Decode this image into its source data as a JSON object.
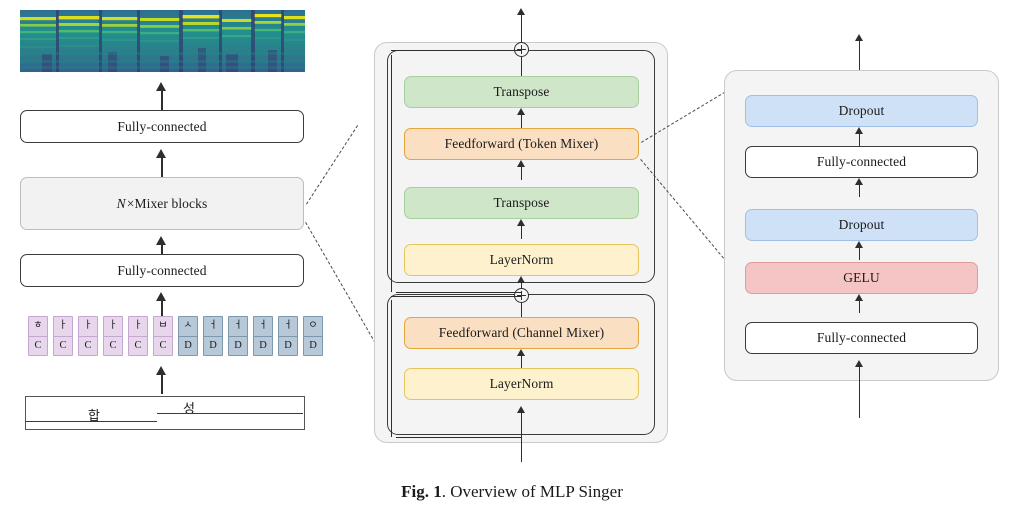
{
  "figure": {
    "caption_label": "Fig. 1",
    "caption_text": ". Overview of MLP Singer"
  },
  "pipeline": {
    "spectrogram": {
      "name": "mel-spectrogram",
      "colormap": "viridis",
      "colors": [
        "#440154",
        "#3b528b",
        "#21918c",
        "#5ec962",
        "#fde725"
      ]
    },
    "blocks": [
      {
        "id": "fc-out",
        "label": "Fully-connected"
      },
      {
        "id": "mixer",
        "label_prefix": "N",
        "label_mul": "×",
        "label_suffix": "Mixer blocks"
      },
      {
        "id": "fc-in",
        "label": "Fully-connected"
      }
    ],
    "tokens": [
      {
        "glyph": "ㅎ",
        "tag": "C",
        "group": "c"
      },
      {
        "glyph": "ㅏ",
        "tag": "C",
        "group": "c"
      },
      {
        "glyph": "ㅏ",
        "tag": "C",
        "group": "c"
      },
      {
        "glyph": "ㅏ",
        "tag": "C",
        "group": "c"
      },
      {
        "glyph": "ㅏ",
        "tag": "C",
        "group": "c"
      },
      {
        "glyph": "ㅂ",
        "tag": "C",
        "group": "c"
      },
      {
        "glyph": "ㅅ",
        "tag": "D",
        "group": "d"
      },
      {
        "glyph": "ㅓ",
        "tag": "D",
        "group": "d"
      },
      {
        "glyph": "ㅓ",
        "tag": "D",
        "group": "d"
      },
      {
        "glyph": "ㅓ",
        "tag": "D",
        "group": "d"
      },
      {
        "glyph": "ㅓ",
        "tag": "D",
        "group": "d"
      },
      {
        "glyph": "ㅇ",
        "tag": "D",
        "group": "d"
      }
    ],
    "score": {
      "name": "lyrics-score",
      "notes": [
        {
          "text": "합"
        },
        {
          "text": "성"
        }
      ]
    }
  },
  "mixer_block": {
    "panel_name": "mixer-block-panel",
    "token_mixer": {
      "name": "token-mixer-sublock",
      "layers": [
        {
          "id": "transpose-top",
          "label": "Transpose",
          "color": "green"
        },
        {
          "id": "ff-token-mixer",
          "label": "Feedforward (Token Mixer)",
          "color": "orange"
        },
        {
          "id": "transpose-bot",
          "label": "Transpose",
          "color": "green"
        },
        {
          "id": "layernorm-token",
          "label": "LayerNorm",
          "color": "yellow"
        }
      ]
    },
    "channel_mixer": {
      "name": "channel-mixer-sublock",
      "layers": [
        {
          "id": "ff-channel-mixer",
          "label": "Feedforward (Channel Mixer)",
          "color": "orange"
        },
        {
          "id": "layernorm-channel",
          "label": "LayerNorm",
          "color": "yellow"
        }
      ]
    },
    "residual_symbol": "⊕"
  },
  "feedforward_block": {
    "panel_name": "feedforward-panel",
    "layers": [
      {
        "id": "dropout-2",
        "label": "Dropout",
        "color": "blue"
      },
      {
        "id": "fc-2",
        "label": "Fully-connected",
        "color": "white"
      },
      {
        "id": "dropout-1",
        "label": "Dropout",
        "color": "blue"
      },
      {
        "id": "gelu",
        "label": "GELU",
        "color": "red"
      },
      {
        "id": "fc-1",
        "label": "Fully-connected",
        "color": "white"
      }
    ]
  },
  "colors": {
    "green": "#cfe6c9",
    "orange": "#fbdfc2",
    "yellow": "#fdf2cd",
    "blue": "#cfe1f6",
    "red": "#f5c4c4",
    "panel": "#f4f4f4",
    "stroke": "#2e2e2e"
  }
}
